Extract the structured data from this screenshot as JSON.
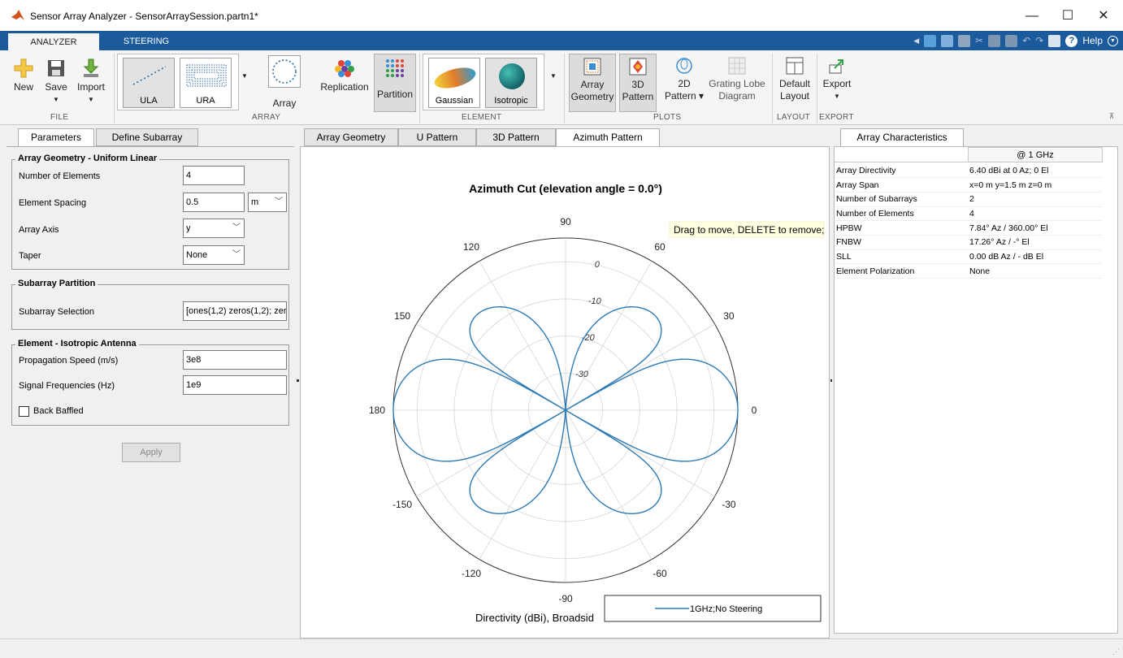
{
  "window": {
    "title": "Sensor Array Analyzer - SensorArraySession.partn1*",
    "minimize": "—",
    "maximize": "☐",
    "close": "✕"
  },
  "ribbon_tabs": [
    "ANALYZER",
    "STEERING"
  ],
  "qat": {
    "help": "Help"
  },
  "ribbon": {
    "file": {
      "label": "FILE",
      "new": "New",
      "save": "Save",
      "import": "Import"
    },
    "array": {
      "label": "ARRAY",
      "ula": "ULA",
      "ura": "URA",
      "array": "Array",
      "replication": "Replication",
      "partition": "Partition"
    },
    "element": {
      "label": "ELEMENT",
      "gaussian": "Gaussian",
      "isotropic": "Isotropic"
    },
    "plots": {
      "label": "PLOTS",
      "array_geometry_1": "Array",
      "array_geometry_2": "Geometry",
      "pattern3d_1": "3D",
      "pattern3d_2": "Pattern",
      "pattern2d_1": "2D",
      "pattern2d_2": "Pattern ▾",
      "grating_1": "Grating Lobe",
      "grating_2": "Diagram"
    },
    "layout": {
      "label": "LAYOUT",
      "default_1": "Default",
      "default_2": "Layout"
    },
    "export": {
      "label": "EXPORT",
      "export": "Export"
    }
  },
  "left_tabs": [
    "Parameters",
    "Define Subarray"
  ],
  "params": {
    "geometry_title": "Array Geometry - Uniform Linear",
    "num_elements_label": "Number of Elements",
    "num_elements": "4",
    "spacing_label": "Element Spacing",
    "spacing": "0.5",
    "spacing_unit": "m",
    "axis_label": "Array Axis",
    "axis": "y",
    "taper_label": "Taper",
    "taper": "None",
    "subarray_title": "Subarray Partition",
    "subarray_sel_label": "Subarray Selection",
    "subarray_sel": "[ones(1,2) zeros(1,2); zeros(1,2) ones(1,2)]",
    "element_title": "Element - Isotropic Antenna",
    "prop_speed_label": "Propagation Speed (m/s)",
    "prop_speed": "3e8",
    "freq_label": "Signal Frequencies (Hz)",
    "freq": "1e9",
    "back_baffled": "Back Baffled",
    "apply": "Apply"
  },
  "plot_tabs": [
    "Array Geometry",
    "U Pattern",
    "3D Pattern",
    "Azimuth Pattern"
  ],
  "plot": {
    "title": "Azimuth Cut (elevation angle = 0.0°)",
    "tooltip": "Drag to move, DELETE to remove;",
    "bottom_label": "Directivity (dBi), Broadsid",
    "legend": "1GHz;No Steering"
  },
  "chart_data": {
    "type": "polar",
    "title": "Azimuth Cut (elevation angle = 0.0°)",
    "angle_ticks": [
      "0",
      "30",
      "60",
      "90",
      "120",
      "150",
      "180",
      "-150",
      "-120",
      "-90",
      "-60",
      "-30"
    ],
    "radial_ticks": [
      "0",
      "-10",
      "-20",
      "-30"
    ],
    "rlim": [
      -40,
      6.4
    ],
    "series": [
      {
        "name": "1GHz;No Steering",
        "color": "#2d7bb6",
        "peak_dbi": 6.4,
        "elements": 4,
        "spacing_lambda": 0.5,
        "axis": "y"
      }
    ]
  },
  "right_tab": "Array Characteristics",
  "characteristics": {
    "header": "@ 1 GHz",
    "rows": [
      [
        "Array Directivity",
        "6.40 dBi at 0 Az; 0 El"
      ],
      [
        "Array Span",
        "x=0 m y=1.5 m z=0 m"
      ],
      [
        "Number of Subarrays",
        "2"
      ],
      [
        "Number of Elements",
        "4"
      ],
      [
        "HPBW",
        "7.84° Az / 360.00° El"
      ],
      [
        "FNBW",
        "17.26° Az / -° El"
      ],
      [
        "SLL",
        "0.00 dB Az / - dB El"
      ],
      [
        "Element Polarization",
        "None"
      ]
    ]
  }
}
